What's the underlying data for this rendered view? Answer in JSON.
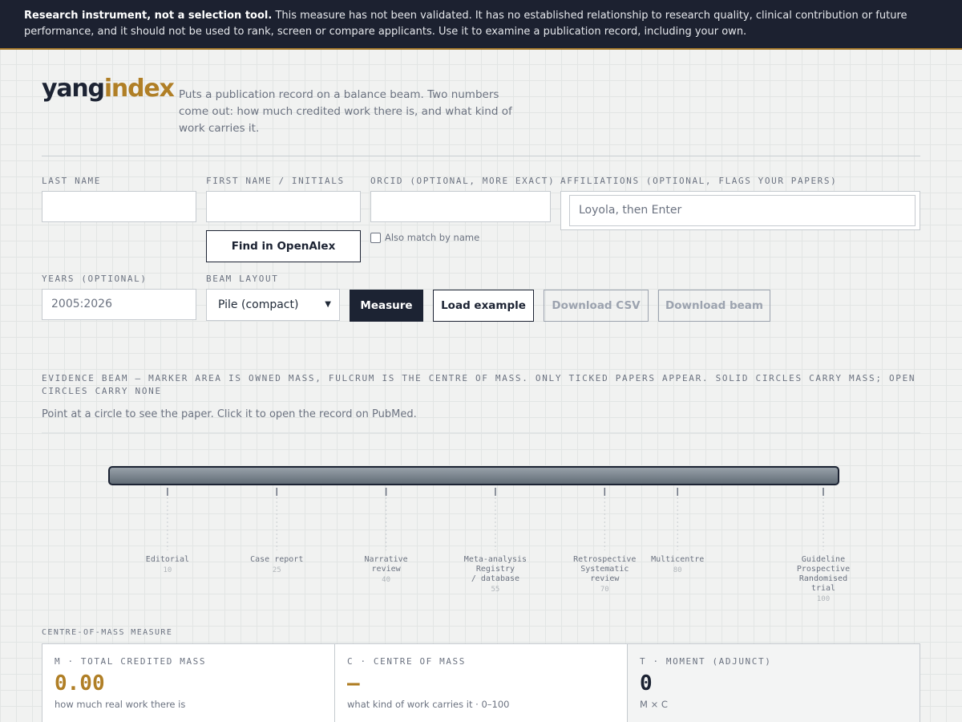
{
  "banner": {
    "strong": "Research instrument, not a selection tool.",
    "text": "This measure has not been validated. It has no established relationship to research quality, clinical contribution or future performance, and it should not be used to rank, screen or compare applicants. Use it to examine a publication record, including your own."
  },
  "brand": {
    "part1": "yang",
    "part2": "index"
  },
  "tagline": "Puts a publication record on a balance beam. Two numbers come out: how much credited work there is, and what kind of work carries it.",
  "form": {
    "last_name_label": "LAST NAME",
    "first_name_label": "FIRST NAME / INITIALS",
    "orcid_label": "ORCID (OPTIONAL, MORE EXACT)",
    "affiliations_label": "AFFILIATIONS (OPTIONAL, FLAGS YOUR PAPERS)",
    "affiliations_placeholder": "Loyola, then Enter",
    "find_button": "Find in OpenAlex",
    "match_by_name": "Also match by name",
    "years_label": "YEARS (OPTIONAL)",
    "years_value": "2005:2026",
    "layout_label": "BEAM LAYOUT",
    "layout_value": "Pile (compact)",
    "measure_button": "Measure",
    "load_example_button": "Load example",
    "download_csv_button": "Download CSV",
    "download_beam_button": "Download beam"
  },
  "section_title": "EVIDENCE BEAM — MARKER AREA IS OWNED MASS, FULCRUM IS THE CENTRE OF MASS. ONLY TICKED PAPERS APPEAR. SOLID CIRCLES CARRY MASS; OPEN CIRCLES CARRY NONE",
  "hint": "Point at a circle to see the paper. Click it to open the record on PubMed.",
  "beam": {
    "scale_min": 0,
    "scale_max": 100,
    "ticks": [
      {
        "lines": [
          "Editorial"
        ],
        "value": "10",
        "pos": 10
      },
      {
        "lines": [
          "Case report"
        ],
        "value": "25",
        "pos": 25
      },
      {
        "lines": [
          "Narrative",
          "review"
        ],
        "value": "40",
        "pos": 40
      },
      {
        "lines": [
          "Meta-analysis",
          "Registry",
          "/ database"
        ],
        "value": "55",
        "pos": 55
      },
      {
        "lines": [
          "Retrospective",
          "Systematic",
          "review"
        ],
        "value": "70",
        "pos": 70
      },
      {
        "lines": [
          "Multicentre"
        ],
        "value": "80",
        "pos": 80
      },
      {
        "lines": [
          "Guideline",
          "Prospective",
          "Randomised",
          "trial"
        ],
        "value": "100",
        "pos": 100
      }
    ]
  },
  "measure": {
    "section_label": "CENTRE-OF-MASS MEASURE",
    "m_label": "M · TOTAL CREDITED MASS",
    "m_value": "0.00",
    "m_sub": "how much real work there is",
    "c_label": "C · CENTRE OF MASS",
    "c_value": "—",
    "c_sub": "what kind of work carries it · 0–100",
    "t_label": "T · MOMENT (ADJUNCT)",
    "t_value": "0",
    "t_sub": "M × C"
  },
  "colors": {
    "accent": "#b07f26",
    "navy": "#1c2333"
  }
}
